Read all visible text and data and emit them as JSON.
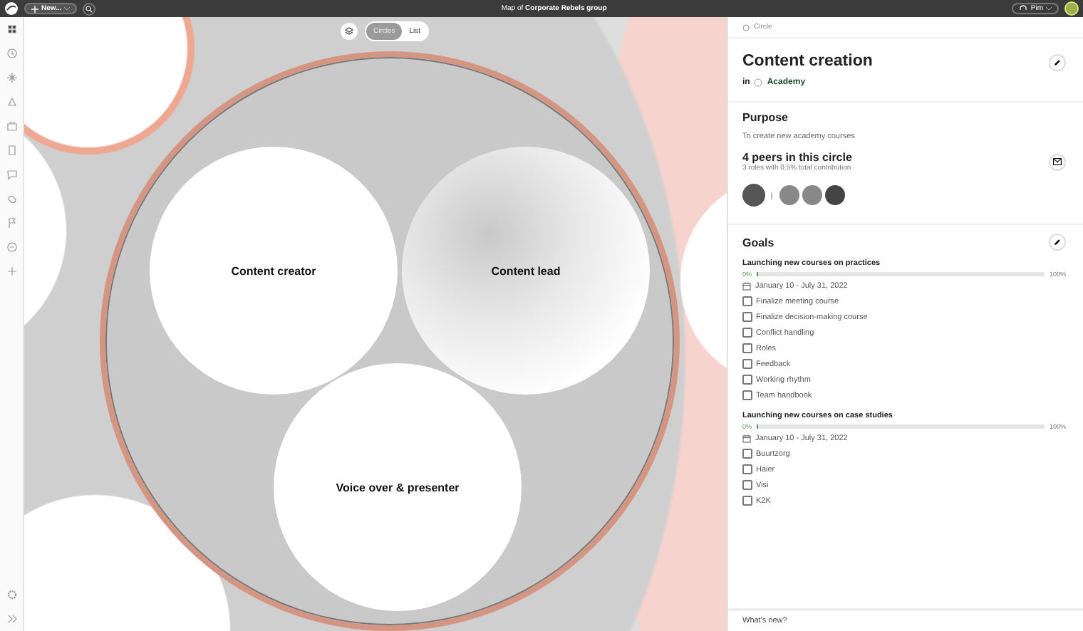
{
  "topbar": {
    "new_button": "New...",
    "title": "Map of **Corporate Rebels group**",
    "user": "Pim"
  },
  "view_toggle": [
    {
      "label": "Circles",
      "selected": true
    },
    {
      "label": "List",
      "selected": false
    }
  ],
  "map": {
    "circles": [
      {
        "label": "Content creator",
        "kind": "plain"
      },
      {
        "label": "Content lead",
        "kind": "shaded"
      },
      {
        "label": "Voice over & presenter",
        "kind": "plain"
      }
    ]
  },
  "panel": {
    "breadcrumb": "Circle",
    "title": "Content creation",
    "parent_prefix": "in",
    "parent": "Academy",
    "purpose_heading": "Purpose",
    "purpose": "To create new academy courses",
    "peers_heading": "4 peers in this circle",
    "peers_sub": "3 roles with 0.5% total contribution",
    "goals_heading": "Goals",
    "goals": [
      {
        "title": "Launching new courses on practices",
        "level": 0,
        "start": "0%",
        "end": "100%",
        "dates": "January 10 - July 31, 2022",
        "tasks": [
          {
            "label": "Finalize meeting course",
            "checked": false
          },
          {
            "label": "Finalize decision-making course",
            "checked": false
          },
          {
            "label": "Conflict handling",
            "checked": false
          },
          {
            "label": "Roles",
            "checked": false
          },
          {
            "label": "Feedback",
            "checked": false
          },
          {
            "label": "Working rhythm",
            "checked": false
          },
          {
            "label": "Team handbook",
            "checked": false
          }
        ]
      },
      {
        "title": "Launching new courses on case studies",
        "level": 0,
        "start": "0%",
        "end": "100%",
        "dates": "January 10 - July 31, 2022",
        "tasks": [
          {
            "label": "Buurtzorg",
            "checked": false
          },
          {
            "label": "Haier",
            "checked": false
          },
          {
            "label": "Visi",
            "checked": false
          },
          {
            "label": "K2K",
            "checked": false
          }
        ]
      }
    ],
    "footer": "What's new?"
  }
}
